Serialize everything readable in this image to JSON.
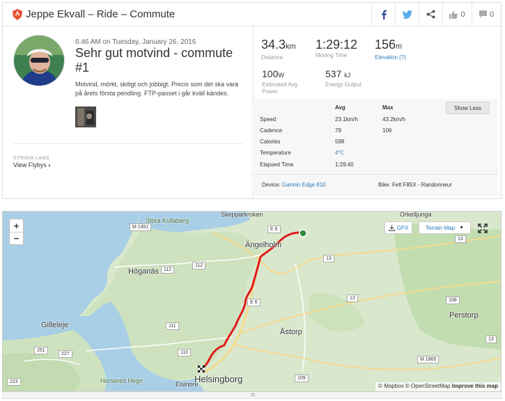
{
  "header": {
    "title": "Jeppe Ekvall – Ride – Commute",
    "kudos_count": "0",
    "comments_count": "0"
  },
  "activity": {
    "timestamp": "6:46 AM on Tuesday, January 26, 2016",
    "name": "Sehr gut motvind - commute #1",
    "description": "Motvind, mörkt, skitigt och jobbigt. Precis som det ska vara på årets första pendling. FTP-passet i går kväll kändes.",
    "labs_label": "STRAVA LABS",
    "flybys_label": "View Flybys"
  },
  "stats": {
    "distance": {
      "value": "34.3",
      "unit": "km",
      "label": "Distance"
    },
    "moving_time": {
      "value": "1:29:12",
      "label": "Moving Time"
    },
    "elevation": {
      "value": "156",
      "unit": "m",
      "label": "Elevation (?)"
    },
    "power": {
      "value": "100",
      "unit": "W",
      "label": "Estimated Avg Power"
    },
    "energy": {
      "value": "537",
      "unit": "kJ",
      "label": "Energy Output"
    }
  },
  "details": {
    "col_avg": "Avg",
    "col_max": "Max",
    "show_less": "Show Less",
    "rows": [
      {
        "label": "Speed",
        "avg": "23.1km/h",
        "max": "43.2km/h"
      },
      {
        "label": "Cadence",
        "avg": "79",
        "max": "106"
      },
      {
        "label": "Calories",
        "avg": "598",
        "max": ""
      },
      {
        "label": "Temperature",
        "avg": "4℃",
        "max": ""
      },
      {
        "label": "Elapsed Time",
        "avg": "1:29:40",
        "max": ""
      }
    ],
    "device_label": "Device:",
    "device_value": "Garmin Edge 810",
    "bike": "Bike: Felt F85X - Randonneur"
  },
  "map": {
    "zoom_in": "+",
    "zoom_out": "−",
    "gpx_label": "GPX",
    "terrain_label": "Terrain Map",
    "attribution": "© Mapbox © OpenStreetMap",
    "improve": "Improve this map",
    "places": {
      "skepparkroken": "Skepparkroken",
      "orkelljunga": "Örkelljunga",
      "angelholm": "Ängelholm",
      "hoganas": "Höganäs",
      "gilleleje": "Gilleleje",
      "astorp": "Åstorp",
      "perstorp": "Perstorp",
      "helsingborg": "Helsingborg",
      "elsinore": "Elsinore",
      "kullaberg": "Stora Kullaberg",
      "horsered": "Horsered Hegn"
    },
    "roads": {
      "m1451": "M 1451",
      "e6a": "E 6",
      "e6b": "E 6",
      "r13a": "13",
      "r13b": "13",
      "r13c": "13",
      "r13d": "13",
      "r112a": "112",
      "r112b": "112",
      "r111": "111",
      "r110": "110",
      "r108": "108",
      "r251": "251",
      "r227": "227",
      "r223": "223",
      "r109": "109",
      "m1865": "M 1865"
    }
  }
}
